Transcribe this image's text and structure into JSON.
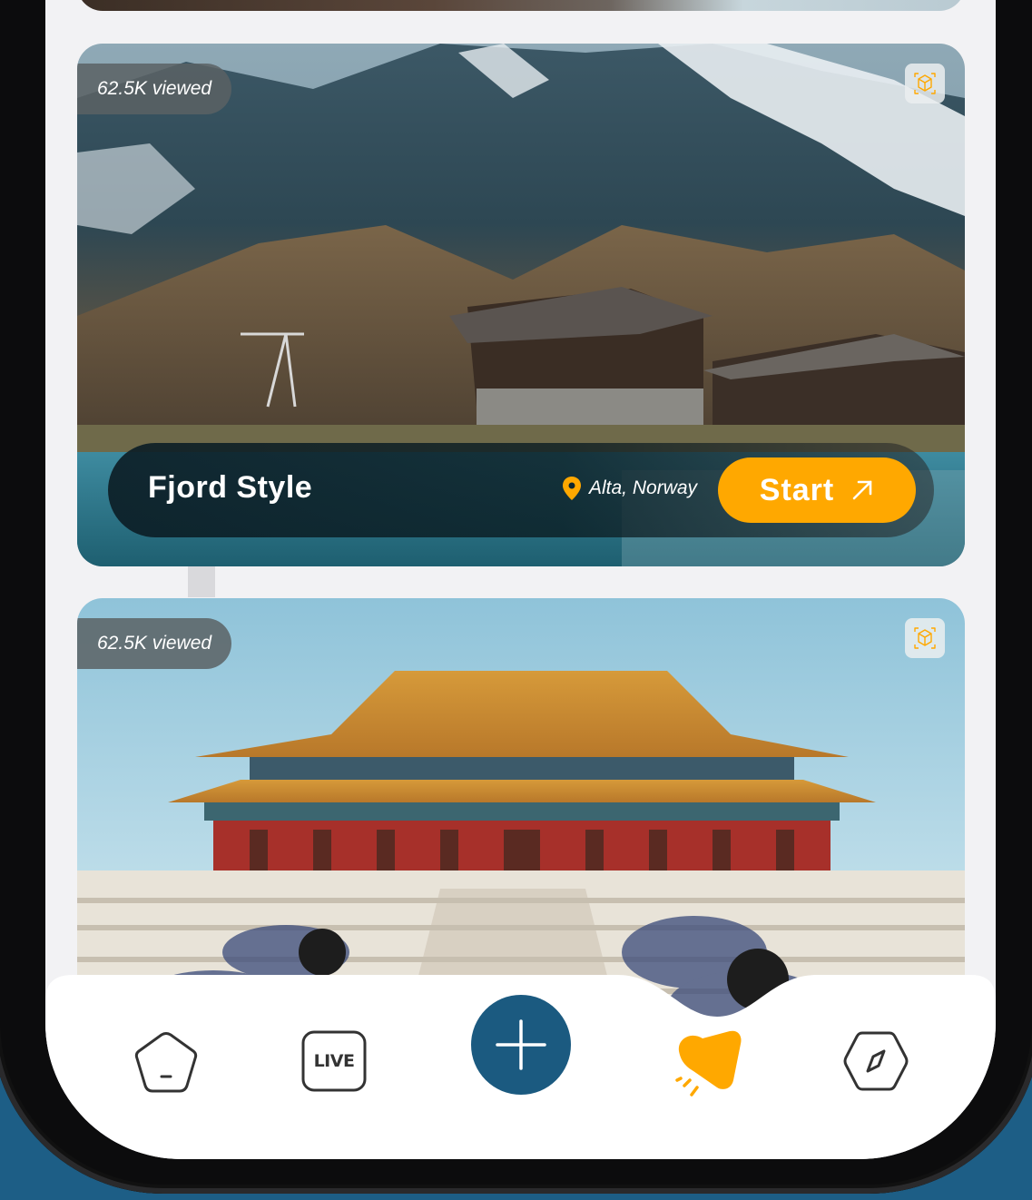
{
  "cards": [
    {
      "viewed": "62.5K viewed",
      "title": "Fjord Style",
      "location": "Alta, Norway",
      "action_label": "Start",
      "ar_icon": "ar-cube-icon",
      "location_icon": "location-pin-icon",
      "action_icon": "arrow-up-right-icon"
    },
    {
      "viewed": "62.5K viewed",
      "ar_icon": "ar-cube-icon"
    }
  ],
  "bottom_nav": {
    "items": [
      {
        "name": "home",
        "icon": "pentagon-home-icon"
      },
      {
        "name": "live",
        "label": "LIVE",
        "icon": "live-icon"
      },
      {
        "name": "add",
        "icon": "plus-icon"
      },
      {
        "name": "favorites",
        "icon": "heart-icon",
        "active": true
      },
      {
        "name": "explore",
        "icon": "compass-icon"
      }
    ]
  },
  "colors": {
    "accent": "#ffa800",
    "primary": "#1b5a80",
    "background": "#1d5e86",
    "icon_inactive": "#333333"
  }
}
